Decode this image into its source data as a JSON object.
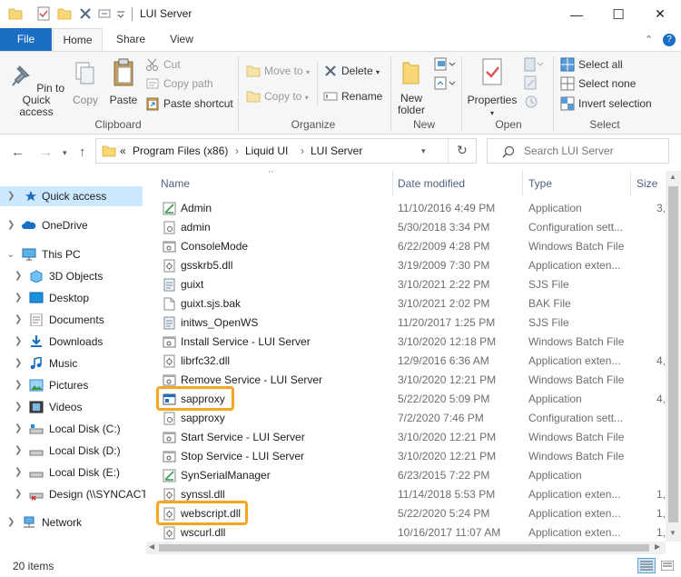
{
  "window": {
    "title": "LUI Server",
    "minimize": "—",
    "maximize": "☐",
    "close": "✕",
    "help": "?",
    "collapse": "⌃"
  },
  "tabs": [
    {
      "label": "File"
    },
    {
      "label": "Home"
    },
    {
      "label": "Share"
    },
    {
      "label": "View"
    }
  ],
  "ribbon": {
    "clipboard": {
      "group": "Clipboard",
      "pin": "Pin to Quick access",
      "copy": "Copy",
      "paste": "Paste",
      "cut": "Cut",
      "copy_path": "Copy path",
      "paste_shortcut": "Paste shortcut"
    },
    "organize": {
      "group": "Organize",
      "move_to": "Move to",
      "copy_to": "Copy to",
      "delete": "Delete",
      "rename": "Rename"
    },
    "new": {
      "group": "New",
      "new_folder": "New folder"
    },
    "open": {
      "group": "Open",
      "properties": "Properties"
    },
    "select": {
      "group": "Select",
      "select_all": "Select all",
      "select_none": "Select none",
      "invert": "Invert selection"
    }
  },
  "address": {
    "overflow": "«",
    "crumbs": [
      "Program Files (x86)",
      "Liquid UI",
      "LUI Server"
    ],
    "search_placeholder": "Search LUI Server"
  },
  "navpane": [
    {
      "label": "Quick access",
      "icon": "star-icon",
      "selected": true
    },
    {
      "label": "OneDrive",
      "icon": "cloud-icon"
    },
    {
      "label": "This PC",
      "icon": "computer-icon",
      "expanded": true
    },
    {
      "label": "3D Objects",
      "icon": "cube-icon"
    },
    {
      "label": "Desktop",
      "icon": "desktop-icon"
    },
    {
      "label": "Documents",
      "icon": "documents-icon"
    },
    {
      "label": "Downloads",
      "icon": "download-icon"
    },
    {
      "label": "Music",
      "icon": "music-icon"
    },
    {
      "label": "Pictures",
      "icon": "pictures-icon"
    },
    {
      "label": "Videos",
      "icon": "videos-icon"
    },
    {
      "label": "Local Disk (C:)",
      "icon": "drive-icon"
    },
    {
      "label": "Local Disk (D:)",
      "icon": "drive-icon"
    },
    {
      "label": "Local Disk (E:)",
      "icon": "drive-icon"
    },
    {
      "label": "Design (\\\\SYNCACT",
      "icon": "network-drive-icon"
    },
    {
      "label": "Network",
      "icon": "network-icon"
    }
  ],
  "columns": {
    "name": "Name",
    "date": "Date modified",
    "type": "Type",
    "size": "Size"
  },
  "files": [
    {
      "name": "Admin",
      "date": "11/10/2016 4:49 PM",
      "type": "Application",
      "size": "3,",
      "icon": "app-icon"
    },
    {
      "name": "admin",
      "date": "5/30/2018 3:34 PM",
      "type": "Configuration sett...",
      "size": "",
      "icon": "config-icon"
    },
    {
      "name": "ConsoleMode",
      "date": "6/22/2009 4:28 PM",
      "type": "Windows Batch File",
      "size": "",
      "icon": "batch-icon"
    },
    {
      "name": "gsskrb5.dll",
      "date": "3/19/2009 7:30 PM",
      "type": "Application exten...",
      "size": "",
      "icon": "dll-icon"
    },
    {
      "name": "guixt",
      "date": "3/10/2021 2:22 PM",
      "type": "SJS File",
      "size": "",
      "icon": "sjs-icon"
    },
    {
      "name": "guixt.sjs.bak",
      "date": "3/10/2021 2:02 PM",
      "type": "BAK File",
      "size": "",
      "icon": "file-icon"
    },
    {
      "name": "initws_OpenWS",
      "date": "11/20/2017 1:25 PM",
      "type": "SJS File",
      "size": "",
      "icon": "sjs-icon"
    },
    {
      "name": "Install Service - LUI Server",
      "date": "3/10/2020 12:18 PM",
      "type": "Windows Batch File",
      "size": "",
      "icon": "batch-icon"
    },
    {
      "name": "librfc32.dll",
      "date": "12/9/2016 6:36 AM",
      "type": "Application exten...",
      "size": "4,",
      "icon": "dll-icon"
    },
    {
      "name": "Remove Service - LUI Server",
      "date": "3/10/2020 12:21 PM",
      "type": "Windows Batch File",
      "size": "",
      "icon": "batch-icon"
    },
    {
      "name": "sapproxy",
      "date": "5/22/2020 5:09 PM",
      "type": "Application",
      "size": "4,",
      "icon": "app-window-icon",
      "highlight": true
    },
    {
      "name": "sapproxy",
      "date": "7/2/2020 7:46 PM",
      "type": "Configuration sett...",
      "size": "",
      "icon": "config-icon"
    },
    {
      "name": "Start Service - LUI Server",
      "date": "3/10/2020 12:21 PM",
      "type": "Windows Batch File",
      "size": "",
      "icon": "batch-icon"
    },
    {
      "name": "Stop Service - LUI Server",
      "date": "3/10/2020 12:21 PM",
      "type": "Windows Batch File",
      "size": "",
      "icon": "batch-icon"
    },
    {
      "name": "SynSerialManager",
      "date": "6/23/2015 7:22 PM",
      "type": "Application",
      "size": "",
      "icon": "app-icon"
    },
    {
      "name": "synssl.dll",
      "date": "11/14/2018 5:53 PM",
      "type": "Application exten...",
      "size": "1,",
      "icon": "dll-icon"
    },
    {
      "name": "webscript.dll",
      "date": "5/22/2020 5:24 PM",
      "type": "Application exten...",
      "size": "1,",
      "icon": "dll-icon",
      "highlight": true
    },
    {
      "name": "wscurl.dll",
      "date": "10/16/2017 11:07 AM",
      "type": "Application exten...",
      "size": "1,",
      "icon": "dll-icon"
    }
  ],
  "status": {
    "count": "20 items"
  },
  "colors": {
    "accent": "#1a6fc4",
    "highlight": "#f5a623",
    "selection": "#cce8ff"
  }
}
